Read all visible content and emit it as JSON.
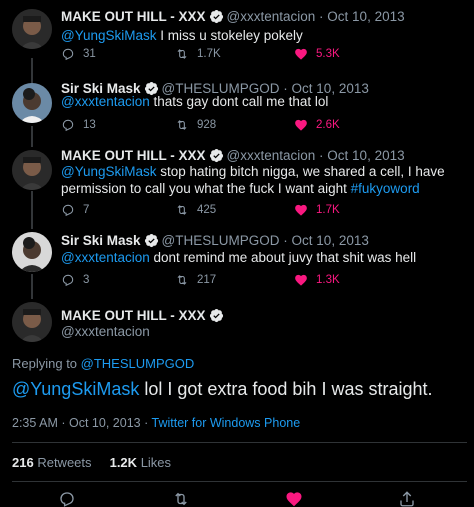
{
  "tweets": [
    {
      "name": "MAKE OUT HILL - XXX",
      "handle": "@xxxtentacion",
      "sep": "·",
      "date": "Oct 10, 2013",
      "mention": "@YungSkiMask",
      "text": " I miss u stokeley pokely",
      "replies": "31",
      "retweets": "1.7K",
      "likes": "5.3K"
    },
    {
      "name": "Sir Ski Mask",
      "handle": "@THESLUMPGOD",
      "sep": "·",
      "date": "Oct 10, 2013",
      "mention": "@xxxtentacion",
      "text": " thats gay dont call me that lol",
      "replies": "13",
      "retweets": "928",
      "likes": "2.6K"
    },
    {
      "name": "MAKE OUT HILL - XXX",
      "handle": "@xxxtentacion",
      "sep": "·",
      "date": "Oct 10, 2013",
      "mention": "@YungSkiMask",
      "text": " stop hating bitch nigga, we shared a cell, I have permission to call you what the fuck I want aight ",
      "hashtag": "#fukyoword",
      "replies": "7",
      "retweets": "425",
      "likes": "1.7K"
    },
    {
      "name": "Sir Ski Mask",
      "handle": "@THESLUMPGOD",
      "sep": "·",
      "date": "Oct 10, 2013",
      "mention": "@xxxtentacion",
      "text": " dont remind me about juvy that shit was hell",
      "replies": "3",
      "retweets": "217",
      "likes": "1.3K"
    }
  ],
  "main": {
    "name": "MAKE OUT HILL - XXX",
    "handle": "@xxxtentacion",
    "replying_prefix": "Replying to ",
    "replying_to": "@THESLUMPGOD",
    "mention": "@YungSkiMask",
    "text": " lol I got extra food bih I was straight.",
    "time": "2:35 AM",
    "sep": "·",
    "date": "Oct 10, 2013",
    "source": "Twitter for Windows Phone",
    "retweets_count": "216",
    "retweets_label": "Retweets",
    "likes_count": "1.2K",
    "likes_label": "Likes"
  },
  "colors": {
    "background": "#000000",
    "link": "#1d9bf0",
    "like": "#f91880",
    "verified": "#e7e9ea",
    "muted": "#8b98a5"
  },
  "icons": [
    "verified-badge-icon",
    "reply-icon",
    "retweet-icon",
    "like-icon",
    "share-icon",
    "avatar"
  ]
}
